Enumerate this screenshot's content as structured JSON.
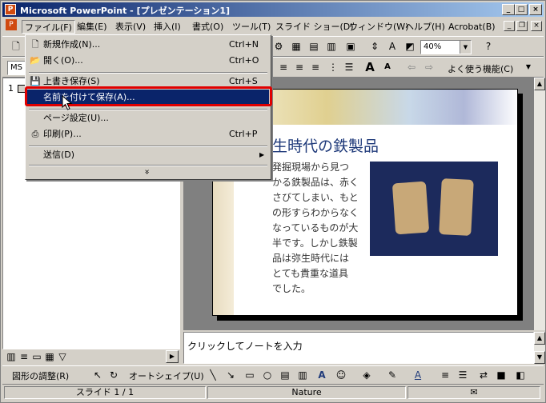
{
  "window": {
    "title": "Microsoft PowerPoint - [プレゼンテーション1]",
    "app_icon": "P"
  },
  "menubar": {
    "items": [
      "ファイル(F)",
      "編集(E)",
      "表示(V)",
      "挿入(I)",
      "書式(O)",
      "ツール(T)",
      "スライド ショー(D)",
      "ウィンドウ(W)",
      "ヘルプ(H)",
      "Acrobat(B)"
    ]
  },
  "toolbar": {
    "zoom_value": "40%",
    "font_box": "MS",
    "frequent_functions": "よく使う機能(C)"
  },
  "file_menu": {
    "items": [
      {
        "label": "新規作成(N)...",
        "shortcut": "Ctrl+N",
        "icon": "new-doc-icon"
      },
      {
        "label": "開く(O)...",
        "shortcut": "Ctrl+O",
        "icon": "open-folder-icon"
      },
      {
        "label": "上書き保存(S)",
        "shortcut": "Ctrl+S",
        "icon": "save-disk-icon"
      },
      {
        "label": "名前を付けて保存(A)...",
        "shortcut": "",
        "icon": ""
      },
      {
        "label": "ページ設定(U)...",
        "shortcut": "",
        "icon": ""
      },
      {
        "label": "印刷(P)...",
        "shortcut": "Ctrl+P",
        "icon": "printer-icon"
      },
      {
        "label": "送信(D)",
        "shortcut": "",
        "icon": ""
      }
    ],
    "more": "»"
  },
  "outline": {
    "slide_number": "1"
  },
  "slide": {
    "title": "生時代の鉄製品",
    "body_lines": [
      "発掘現場から見つ",
      "かる鉄製品は、赤く",
      "さびてしまい、もと",
      "の形すらわからなく",
      "なっているものが大",
      "半です。しかし鉄製",
      "品は弥生時代には",
      "とても貴重な道具",
      "でした。"
    ]
  },
  "notes": {
    "placeholder": "クリックしてノートを入力"
  },
  "drawing_toolbar": {
    "adjust": "図形の調整(R)",
    "autoshape": "オートシェイプ(U)"
  },
  "statusbar": {
    "slide": "スライド 1 / 1",
    "template": "Nature"
  },
  "colors": {
    "titlebar_start": "#0a246a",
    "titlebar_end": "#a6caf0",
    "highlight": "#0a246a",
    "annotation_box": "#e00000",
    "slide_title": "#1f3a7a"
  }
}
